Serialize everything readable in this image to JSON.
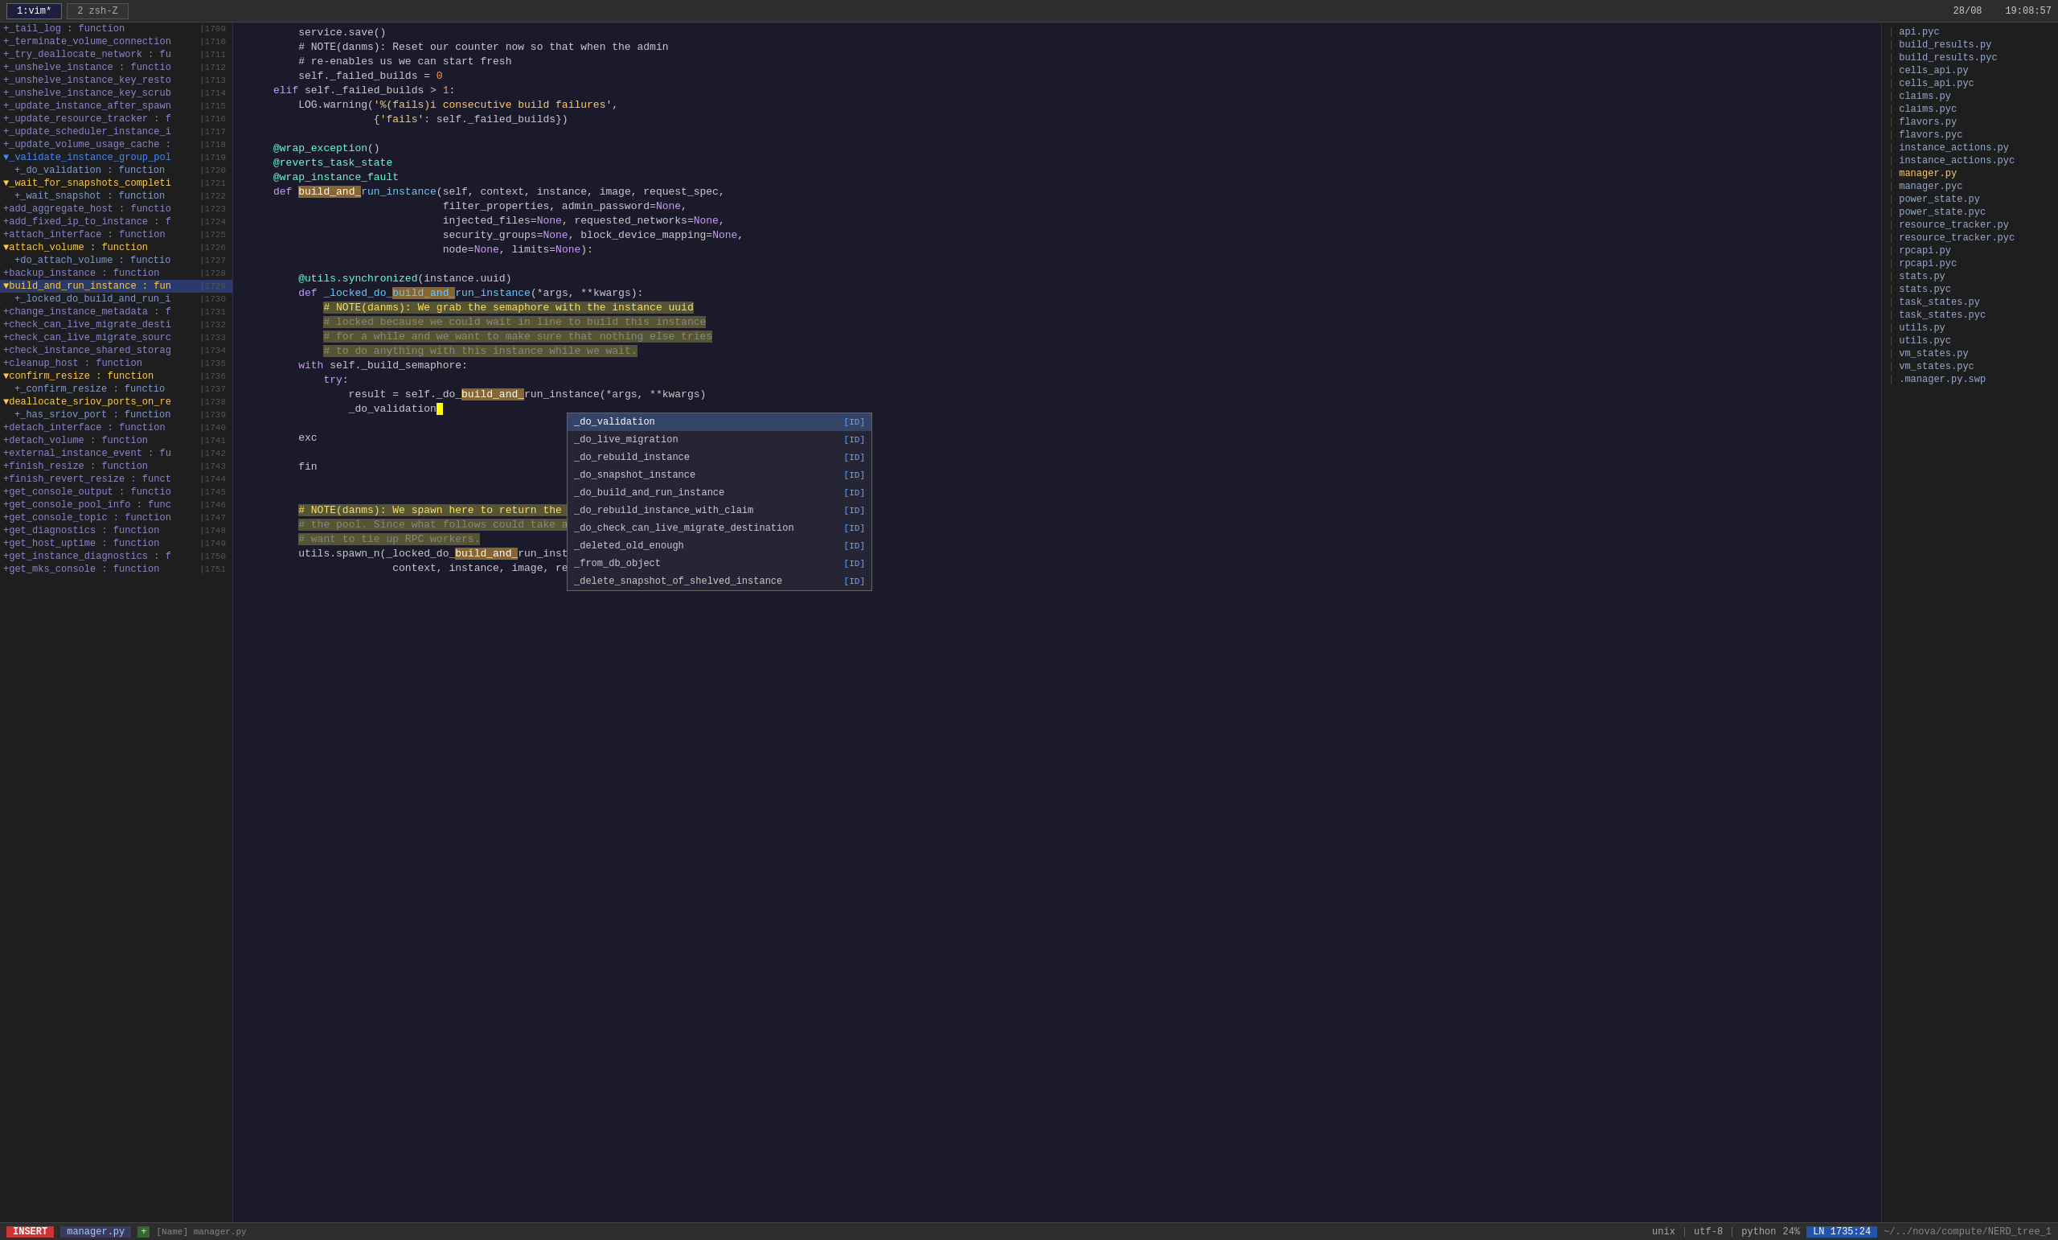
{
  "topbar": {
    "tab1": "1:vim*",
    "tab2": "2  zsh-Z",
    "position": "28/08",
    "time": "19:08:57"
  },
  "sidebar": {
    "items": [
      {
        "id": "s1",
        "text": "+_tail_log : function",
        "linenum": "1709",
        "level": 0,
        "style": "normal"
      },
      {
        "id": "s2",
        "text": "+_terminate_volume_connection",
        "linenum": "1710",
        "level": 0,
        "style": "normal"
      },
      {
        "id": "s3",
        "text": "+_try_deallocate_network : fu",
        "linenum": "1711",
        "level": 0,
        "style": "normal"
      },
      {
        "id": "s4",
        "text": "+_unshelve_instance : functio",
        "linenum": "1712",
        "level": 0,
        "style": "normal"
      },
      {
        "id": "s5",
        "text": "+_unshelve_instance_key_resto",
        "linenum": "1713",
        "level": 0,
        "style": "normal"
      },
      {
        "id": "s6",
        "text": "+_unshelve_instance_key_scrub",
        "linenum": "1714",
        "level": 0,
        "style": "normal"
      },
      {
        "id": "s7",
        "text": "+_update_instance_after_spawn",
        "linenum": "1715",
        "level": 0,
        "style": "normal"
      },
      {
        "id": "s8",
        "text": "+_update_resource_tracker : f",
        "linenum": "1716",
        "level": 0,
        "style": "normal"
      },
      {
        "id": "s9",
        "text": "+_update_scheduler_instance_i",
        "linenum": "1717",
        "level": 0,
        "style": "normal"
      },
      {
        "id": "s10",
        "text": "+_update_volume_usage_cache :",
        "linenum": "1718",
        "level": 0,
        "style": "normal"
      },
      {
        "id": "s11",
        "text": "▼_validate_instance_group_pol",
        "linenum": "1719",
        "level": 0,
        "style": "fold-open"
      },
      {
        "id": "s12",
        "text": "+_do_validation : function",
        "linenum": "1720",
        "level": 1,
        "style": "sub"
      },
      {
        "id": "s13",
        "text": "▼_wait_for_snapshots_completi",
        "linenum": "1721",
        "level": 0,
        "style": "fold-open-yellow"
      },
      {
        "id": "s14",
        "text": "+_wait_snapshot : function",
        "linenum": "1722",
        "level": 1,
        "style": "sub"
      },
      {
        "id": "s15",
        "text": "+add_aggregate_host : functio",
        "linenum": "1723",
        "level": 0,
        "style": "normal"
      },
      {
        "id": "s16",
        "text": "+add_fixed_ip_to_instance : f",
        "linenum": "1724",
        "level": 0,
        "style": "normal"
      },
      {
        "id": "s17",
        "text": "+attach_interface : function",
        "linenum": "1725",
        "level": 0,
        "style": "normal"
      },
      {
        "id": "s18",
        "text": "▼attach_volume : function",
        "linenum": "1726",
        "level": 0,
        "style": "fold-open-yellow"
      },
      {
        "id": "s19",
        "text": "+do_attach_volume : functio",
        "linenum": "1727",
        "level": 1,
        "style": "sub"
      },
      {
        "id": "s20",
        "text": "+backup_instance : function",
        "linenum": "1728",
        "level": 0,
        "style": "normal"
      },
      {
        "id": "s21",
        "text": "▼build_and_run_instance : fun",
        "linenum": "1729",
        "level": 0,
        "style": "fold-open-yellow active"
      },
      {
        "id": "s22",
        "text": "+_locked_do_build_and_run_i",
        "linenum": "1730",
        "level": 1,
        "style": "sub"
      },
      {
        "id": "s23",
        "text": "+change_instance_metadata : f",
        "linenum": "1731",
        "level": 0,
        "style": "normal"
      },
      {
        "id": "s24",
        "text": "+check_can_live_migrate_desti",
        "linenum": "1732",
        "level": 0,
        "style": "normal"
      },
      {
        "id": "s25",
        "text": "+check_can_live_migrate_sourc",
        "linenum": "1733",
        "level": 0,
        "style": "normal"
      },
      {
        "id": "s26",
        "text": "+check_instance_shared_storag",
        "linenum": "1734",
        "level": 0,
        "style": "normal"
      },
      {
        "id": "s27",
        "text": "+cleanup_host : function",
        "linenum": "1735",
        "level": 0,
        "style": "normal"
      },
      {
        "id": "s28",
        "text": "▼confirm_resize : function",
        "linenum": "1736",
        "level": 0,
        "style": "fold-open-yellow"
      },
      {
        "id": "s29",
        "text": "+_confirm_resize : functio",
        "linenum": "1737",
        "level": 1,
        "style": "sub"
      },
      {
        "id": "s30",
        "text": "▼deallocate_sriov_ports_on_re",
        "linenum": "1738",
        "level": 0,
        "style": "fold-open-yellow"
      },
      {
        "id": "s31",
        "text": "+_has_sriov_port : function",
        "linenum": "1739",
        "level": 1,
        "style": "sub"
      },
      {
        "id": "s32",
        "text": "+detach_interface : function",
        "linenum": "1740",
        "level": 0,
        "style": "normal"
      },
      {
        "id": "s33",
        "text": "+detach_volume : function",
        "linenum": "1741",
        "level": 0,
        "style": "normal"
      },
      {
        "id": "s34",
        "text": "+external_instance_event : fu",
        "linenum": "1742",
        "level": 0,
        "style": "normal"
      },
      {
        "id": "s35",
        "text": "+finish_resize : function",
        "linenum": "1743",
        "level": 0,
        "style": "normal"
      },
      {
        "id": "s36",
        "text": "+finish_revert_resize : funct",
        "linenum": "1744",
        "level": 0,
        "style": "normal"
      },
      {
        "id": "s37",
        "text": "+get_console_output : functio",
        "linenum": "1745",
        "level": 0,
        "style": "normal"
      },
      {
        "id": "s38",
        "text": "+get_console_pool_info : func",
        "linenum": "1746",
        "level": 0,
        "style": "normal"
      },
      {
        "id": "s39",
        "text": "+get_console_topic : function",
        "linenum": "1747",
        "level": 0,
        "style": "normal"
      },
      {
        "id": "s40",
        "text": "+get_diagnostics : function",
        "linenum": "1748",
        "level": 0,
        "style": "normal"
      },
      {
        "id": "s41",
        "text": "+get_host_uptime : function",
        "linenum": "1749",
        "level": 0,
        "style": "normal"
      },
      {
        "id": "s42",
        "text": "+get_instance_diagnostics : f",
        "linenum": "1750",
        "level": 0,
        "style": "normal"
      },
      {
        "id": "s43",
        "text": "+get_mks_console : function",
        "linenum": "1751",
        "level": 0,
        "style": "normal"
      }
    ]
  },
  "editor": {
    "lines": [
      {
        "ln": "",
        "code": "    service.save()"
      },
      {
        "ln": "",
        "code": "    # NOTE(danms): Reset our counter now so that when the admin"
      },
      {
        "ln": "",
        "code": "    # re-enables us we can start fresh"
      },
      {
        "ln": "",
        "code": "    self._failed_builds = 0"
      },
      {
        "ln": "",
        "code": "elif self._failed_builds > 1:"
      },
      {
        "ln": "",
        "code": "    LOG.warning('%(fails)i consecutive build failures',"
      },
      {
        "ln": "",
        "code": "                {'fails': self._failed_builds})"
      },
      {
        "ln": "",
        "code": ""
      },
      {
        "ln": "",
        "code": "@wrap_exception()"
      },
      {
        "ln": "",
        "code": "@reverts_task_state"
      },
      {
        "ln": "",
        "code": "@wrap_instance_fault"
      },
      {
        "ln": "",
        "code": "def build_and_run_instance(self, context, instance, image, request_spec,"
      },
      {
        "ln": "",
        "code": "                           filter_properties, admin_password=None,"
      },
      {
        "ln": "",
        "code": "                           injected_files=None, requested_networks=None,"
      },
      {
        "ln": "",
        "code": "                           security_groups=None, block_device_mapping=None,"
      },
      {
        "ln": "",
        "code": "                           node=None, limits=None):"
      },
      {
        "ln": "",
        "code": ""
      },
      {
        "ln": "",
        "code": "    @utils.synchronized(instance.uuid)"
      },
      {
        "ln": "",
        "code": "    def _locked_do_build_and_run_instance(*args, **kwargs):"
      },
      {
        "ln": "",
        "code": "        # NOTE(danms): We grab the semaphore with the instance uuid"
      },
      {
        "ln": "",
        "code": "        # locked because we could wait in line to build this instance"
      },
      {
        "ln": "",
        "code": "        # for a while and we want to make sure that nothing else tries"
      },
      {
        "ln": "",
        "code": "        # to do anything with this instance while we wait."
      },
      {
        "ln": "",
        "code": "    with self._build_semaphore:"
      },
      {
        "ln": "",
        "code": "        try:"
      },
      {
        "ln": "",
        "code": "            result = self._do_build_and_run_instance(*args, **kwargs)"
      },
      {
        "ln": "",
        "code": "            _do_validation"
      }
    ]
  },
  "autocomplete": {
    "items": [
      {
        "name": "_do_validation",
        "type": "[ID]",
        "selected": true
      },
      {
        "name": "_do_live_migration",
        "type": "[ID]",
        "selected": false
      },
      {
        "name": "_do_rebuild_instance",
        "type": "[ID]",
        "selected": false
      },
      {
        "name": "_do_snapshot_instance",
        "type": "[ID]",
        "selected": false
      },
      {
        "name": "_do_build_and_run_instance",
        "type": "[ID]",
        "selected": false
      },
      {
        "name": "_do_rebuild_instance_with_claim",
        "type": "[ID]",
        "selected": false
      },
      {
        "name": "_do_check_can_live_migrate_destination",
        "type": "[ID]",
        "selected": false
      },
      {
        "name": "_deleted_old_enough",
        "type": "[ID]",
        "selected": false
      },
      {
        "name": "_from_db_object",
        "type": "[ID]",
        "selected": false
      },
      {
        "name": "_delete_snapshot_of_shelved_instance",
        "type": "[ID]",
        "selected": false
      }
    ]
  },
  "filesidebar": {
    "items": [
      "api.pyc",
      "build_results.py",
      "build_results.pyc",
      "cells_api.py",
      "cells_api.pyc",
      "claims.py",
      "claims.pyc",
      "flavors.py",
      "flavors.pyc",
      "instance_actions.py",
      "instance_actions.pyc",
      "manager.py",
      "manager.pyc",
      "power_state.py",
      "power_state.pyc",
      "resource_tracker.py",
      "resource_tracker.pyc",
      "rpcapi.py",
      "rpcapi.pyc",
      "stats.py",
      "stats.pyc",
      "task_states.py",
      "task_states.pyc",
      "utils.py",
      "utils.pyc",
      "vm_states.py",
      "vm_states.pyc",
      ".manager.py.swp"
    ]
  },
  "statusbar": {
    "mode": "INSERT",
    "filename": "manager.py",
    "plus": "+",
    "encoding": "unix",
    "charset": "utf-8",
    "filetype": "python",
    "percent": "24%",
    "position": "LN 1735:24",
    "path": "~/../nova/compute/NERD_tree_1",
    "name_label": "[Name] manager.py"
  }
}
